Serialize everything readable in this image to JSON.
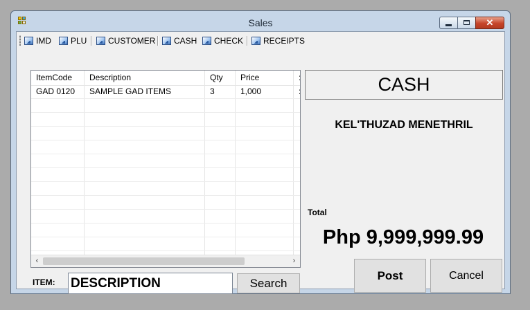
{
  "window": {
    "title": "Sales"
  },
  "toolbar": {
    "items": [
      {
        "label": "IMD",
        "icon": "image-icon"
      },
      {
        "label": "PLU",
        "icon": "image-icon"
      },
      {
        "label": "CUSTOMER",
        "icon": "image-icon"
      },
      {
        "label": "CASH",
        "icon": "image-icon"
      },
      {
        "label": "CHECK",
        "icon": "image-icon"
      },
      {
        "label": "RECEIPTS",
        "icon": "image-icon"
      }
    ]
  },
  "grid": {
    "columns": [
      "ItemCode",
      "Description",
      "Qty",
      "Price",
      ":"
    ],
    "rows": [
      [
        "GAD 0120",
        "SAMPLE GAD ITEMS",
        "3",
        "1,000",
        ":"
      ]
    ],
    "scroll_left": "‹",
    "scroll_right": "›"
  },
  "item": {
    "label": "ITEM:",
    "value": "DESCRIPTION"
  },
  "search_label": "Search",
  "payment": {
    "type": "CASH",
    "customer": "KEL'THUZAD MENETHRIL",
    "total_label": "Total",
    "total_amount": "Php 9,999,999.99"
  },
  "actions": {
    "post": "Post",
    "cancel": "Cancel"
  },
  "colors": {
    "close_button": "#c6452a",
    "window_frame": "#c6d6e8",
    "client_bg": "#f0f0f0"
  }
}
